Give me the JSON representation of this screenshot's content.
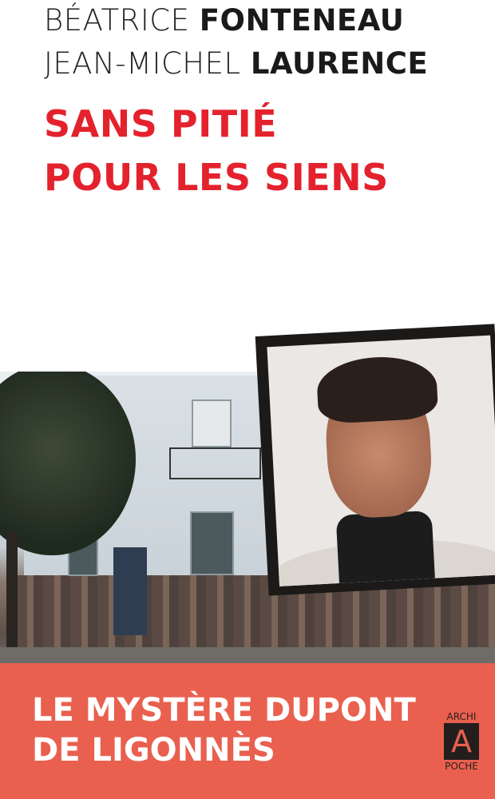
{
  "authors": [
    {
      "first": "BÉATRICE",
      "last": "FONTENEAU"
    },
    {
      "first": "JEAN-MICHEL",
      "last": "LAURENCE"
    }
  ],
  "title": {
    "line1": "SANS PITIÉ",
    "line2": "POUR LES SIENS"
  },
  "subtitle": {
    "line1": "LE MYSTÈRE DUPONT",
    "line2": "DE LIGONNÈS"
  },
  "publisher_logo": {
    "top": "ARCHI",
    "letter": "A",
    "bottom": "POCHE"
  },
  "colors": {
    "title_red": "#e3222d",
    "band": "#e9604f"
  }
}
